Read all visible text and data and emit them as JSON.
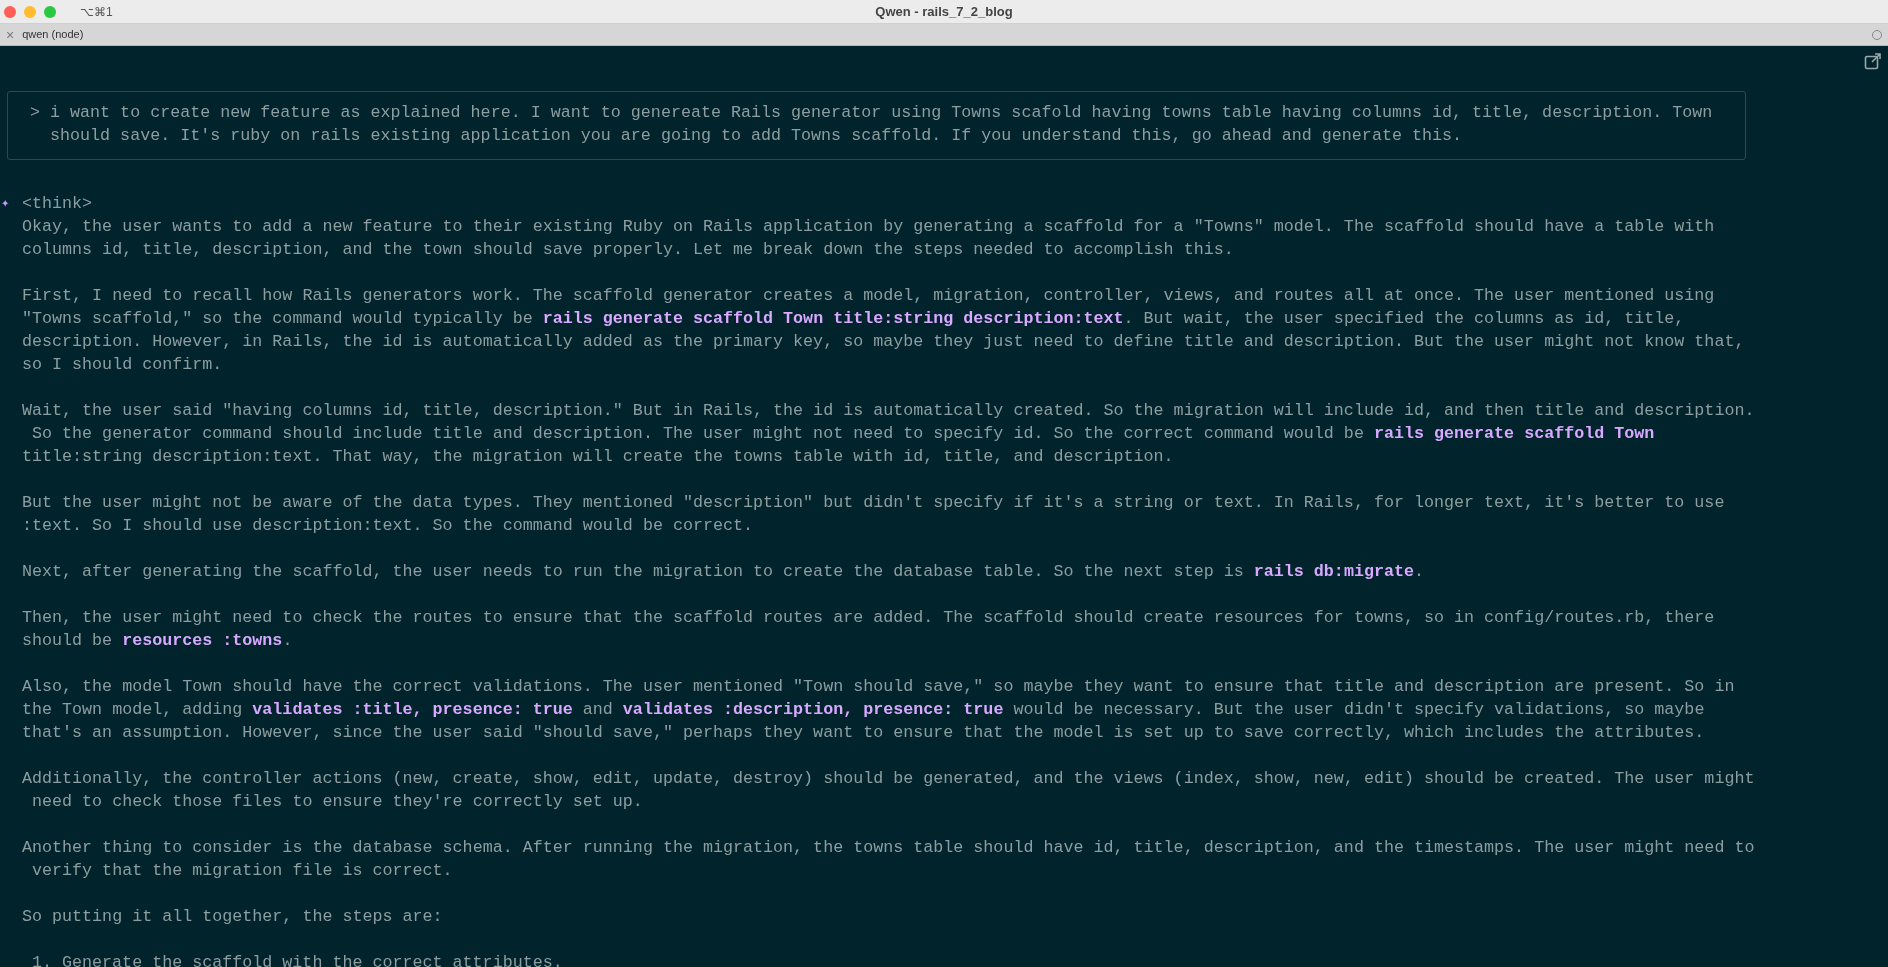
{
  "window": {
    "shortcut": "⌥⌘1",
    "title": "Qwen - rails_7_2_blog"
  },
  "tab": {
    "close": "×",
    "label": "qwen (node)"
  },
  "prompt": {
    "marker": ">",
    "lines": [
      "i want to create new feature as explained here. I want to genereate Rails generator using Towns scafold having towns table having columns id, title, description. Town",
      "should save. It's ruby on rails existing application you are going to add Towns scaffold. If you understand this, go ahead and generate this."
    ]
  },
  "response": {
    "marker": "✦",
    "header": "<think>",
    "paragraphs": [
      [
        "Okay, the user wants to add a new feature to their existing Ruby on Rails application by generating a scaffold for a \"Towns\" model. The scaffold should have a table with",
        "columns id, title, description, and the town should save properly. Let me break down the steps needed to accomplish this."
      ],
      [
        "First, I need to recall how Rails generators work. The scaffold generator creates a model, migration, controller, views, and routes all at once. The user mentioned using",
        "\"Towns scaffold,\" so the command would typically be **rails generate scaffold Town title:string description:text**. But wait, the user specified the columns as id, title,",
        "description. However, in Rails, the id is automatically added as the primary key, so maybe they just need to define title and description. But the user might not know that,",
        "so I should confirm."
      ],
      [
        "Wait, the user said \"having columns id, title, description.\" But in Rails, the id is automatically created. So the migration will include id, and then title and description.",
        " So the generator command should include title and description. The user might not need to specify id. So the correct command would be **rails generate scaffold Town**",
        "title:string description:text. That way, the migration will create the towns table with id, title, and description."
      ],
      [
        "But the user might not be aware of the data types. They mentioned \"description\" but didn't specify if it's a string or text. In Rails, for longer text, it's better to use",
        ":text. So I should use description:text. So the command would be correct."
      ],
      [
        "Next, after generating the scaffold, the user needs to run the migration to create the database table. So the next step is **rails db:migrate**."
      ],
      [
        "Then, the user might need to check the routes to ensure that the scaffold routes are added. The scaffold should create resources for towns, so in config/routes.rb, there",
        "should be **resources :towns**."
      ],
      [
        "Also, the model Town should have the correct validations. The user mentioned \"Town should save,\" so maybe they want to ensure that title and description are present. So in",
        "the Town model, adding **validates :title, presence: true** and **validates :description, presence: true** would be necessary. But the user didn't specify validations, so maybe",
        "that's an assumption. However, since the user said \"should save,\" perhaps they want to ensure that the model is set up to save correctly, which includes the attributes."
      ],
      [
        "Additionally, the controller actions (new, create, show, edit, update, destroy) should be generated, and the views (index, show, new, edit) should be created. The user might",
        " need to check those files to ensure they're correctly set up."
      ],
      [
        "Another thing to consider is the database schema. After running the migration, the towns table should have id, title, description, and the timestamps. The user might need to",
        " verify that the migration file is correct."
      ],
      [
        "So putting it all together, the steps are:"
      ]
    ],
    "steps": [
      {
        "number": "1.",
        "text": "Generate the scaffold with the correct attributes."
      }
    ]
  }
}
